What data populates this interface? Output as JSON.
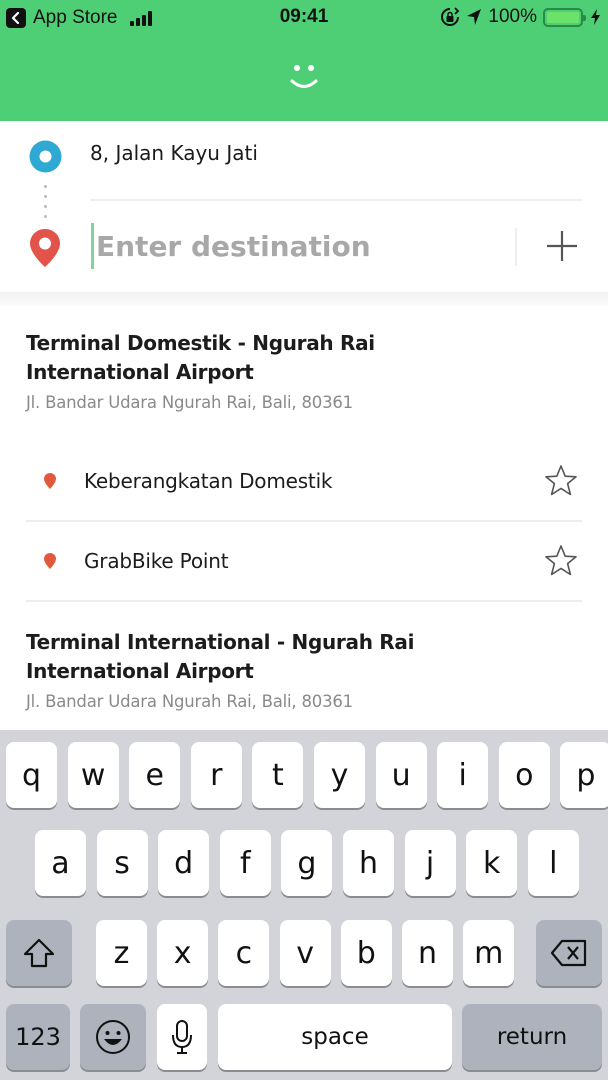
{
  "status_bar": {
    "back_app": "App Store",
    "time": "09:41",
    "battery": "100%",
    "icons": [
      "back-icon",
      "signal-icon",
      "orientation-lock-icon",
      "location-arrow-icon",
      "battery-icon",
      "charging-icon"
    ]
  },
  "header": {
    "logo_icon": "smiley-icon",
    "color": "#4fcf75"
  },
  "route": {
    "origin": "8, Jalan Kayu Jati",
    "destination_value": "",
    "destination_placeholder": "Enter destination",
    "origin_color": "#2fa9d4",
    "destination_color": "#e2534a",
    "add_stop_icon": "plus-icon"
  },
  "results": [
    {
      "title": "Terminal Domestik - Ngurah Rai International Airport",
      "address": "Jl. Bandar Udara Ngurah Rai, Bali, 80361",
      "sub_points": [
        {
          "label": "Keberangkatan Domestik",
          "icon": "pin-icon",
          "action_icon": "star-icon"
        },
        {
          "label": "GrabBike Point",
          "icon": "pin-icon",
          "action_icon": "star-icon"
        }
      ]
    },
    {
      "title": "Terminal International - Ngurah Rai International Airport",
      "address": "Jl. Bandar Udara Ngurah Rai, Bali, 80361",
      "sub_points": []
    }
  ],
  "keyboard": {
    "row1": [
      "q",
      "w",
      "e",
      "r",
      "t",
      "y",
      "u",
      "i",
      "o",
      "p"
    ],
    "row2": [
      "a",
      "s",
      "d",
      "f",
      "g",
      "h",
      "j",
      "k",
      "l"
    ],
    "row3": [
      "z",
      "x",
      "c",
      "v",
      "b",
      "n",
      "m"
    ],
    "numbers_label": "123",
    "space_label": "space",
    "return_label": "return"
  }
}
